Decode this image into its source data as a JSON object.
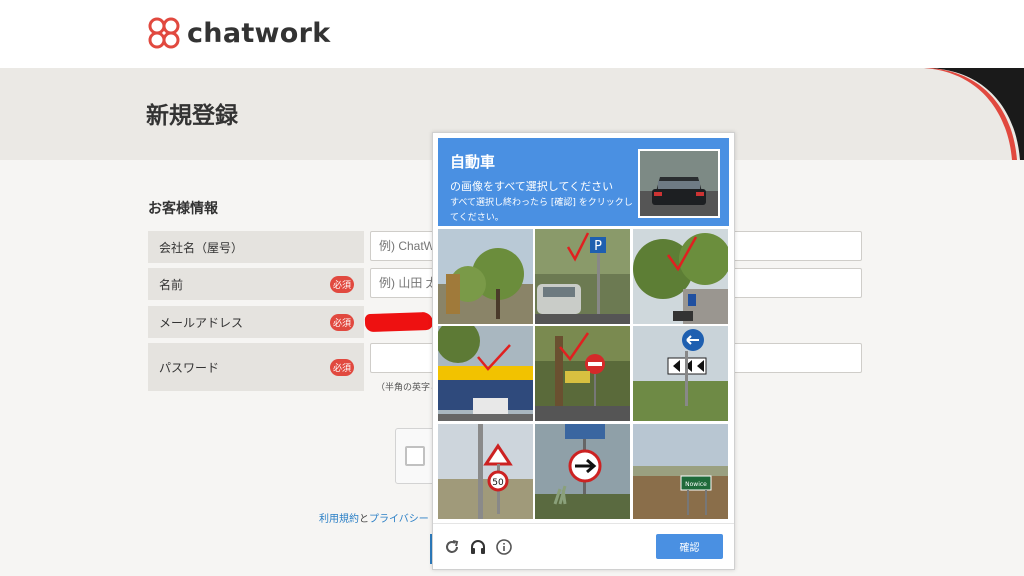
{
  "brand": {
    "name": "chatwork"
  },
  "page": {
    "title": "新規登録"
  },
  "form": {
    "section_title": "お客様情報",
    "required_badge": "必須",
    "fields": [
      {
        "label": "会社名（屋号）",
        "placeholder": "例) ChatW",
        "required": false
      },
      {
        "label": "名前",
        "placeholder": "例) 山田 太",
        "required": true
      },
      {
        "label": "メールアドレス",
        "placeholder": "",
        "required": true
      },
      {
        "label": "パスワード",
        "placeholder": "",
        "required": true
      }
    ],
    "password_hint": "（半角の英字と",
    "terms": {
      "terms_link": "利用規約",
      "connector": "と",
      "privacy_link": "プライバシー"
    }
  },
  "captcha": {
    "title": "自動車",
    "line1": "の画像をすべて選択してください",
    "line2": "すべて選択し終わったら [確認] をクリックしてください。",
    "tiles": [
      {
        "icon": "street-trees",
        "checked": false
      },
      {
        "icon": "parking-sign-car",
        "checked": true
      },
      {
        "icon": "trees-street",
        "checked": true
      },
      {
        "icon": "shop-truck",
        "checked": true
      },
      {
        "icon": "no-entry-sign",
        "checked": true
      },
      {
        "icon": "roundabout-arrows",
        "checked": false
      },
      {
        "icon": "speed-limit-50",
        "checked": false
      },
      {
        "icon": "arrow-sign",
        "checked": false
      },
      {
        "icon": "field-town-sign",
        "checked": false
      }
    ],
    "town_sign_text": "Nowice",
    "speed_text": "50",
    "verify_label": "確認",
    "icons": [
      "reload-icon",
      "audio-icon",
      "info-icon"
    ]
  },
  "colors": {
    "accent": "#4a90e2",
    "required": "#e1493f",
    "brand_red": "#e1493f"
  }
}
